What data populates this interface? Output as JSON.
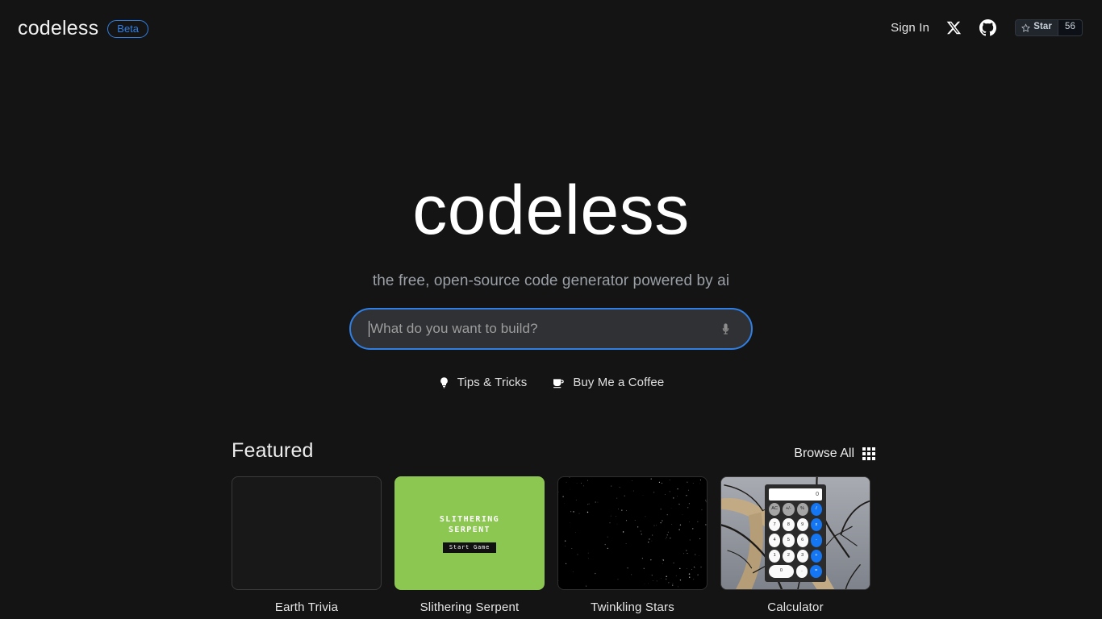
{
  "topbar": {
    "brand": "codeless",
    "badge": "Beta",
    "sign_in": "Sign In",
    "x_icon": "x-twitter-icon",
    "github_icon": "github-icon",
    "github_star": {
      "star_icon": "star-outline-icon",
      "label": "Star",
      "count": "56"
    }
  },
  "hero": {
    "title": "codeless",
    "subtitle": "the free, open-source code generator powered by ai",
    "search": {
      "value": "",
      "placeholder": "What do you want to build?",
      "mic_icon": "microphone-icon"
    },
    "quick_links": [
      {
        "label": "Tips & Tricks",
        "icon": "lightbulb-icon"
      },
      {
        "label": "Buy Me a Coffee",
        "icon": "coffee-cup-icon"
      }
    ]
  },
  "featured": {
    "title": "Featured",
    "browse_all": "Browse All",
    "grid_icon": "grid-3x3-icon",
    "cards": [
      {
        "label": "Earth Trivia",
        "thumb": "blank-dark"
      },
      {
        "label": "Slithering Serpent",
        "thumb": "snake-game",
        "preview": {
          "title_line1": "SLITHERING",
          "title_line2": "SERPENT",
          "button": "Start Game",
          "bg_color": "#8cc751"
        }
      },
      {
        "label": "Twinkling Stars",
        "thumb": "starfield",
        "preview": {
          "bg_color": "#000000"
        }
      },
      {
        "label": "Calculator",
        "thumb": "calculator",
        "preview": {
          "display": "0",
          "keys": [
            [
              "AC",
              "+/-",
              "%",
              "/"
            ],
            [
              "7",
              "8",
              "9",
              "x"
            ],
            [
              "4",
              "5",
              "6",
              "-"
            ],
            [
              "1",
              "2",
              "3",
              "+"
            ],
            [
              "0",
              ".",
              "="
            ]
          ],
          "accent_color": "#1476f2"
        }
      }
    ]
  },
  "colors": {
    "background": "#141414",
    "accent_blue": "#2f7fe4",
    "search_bg": "#303134"
  }
}
